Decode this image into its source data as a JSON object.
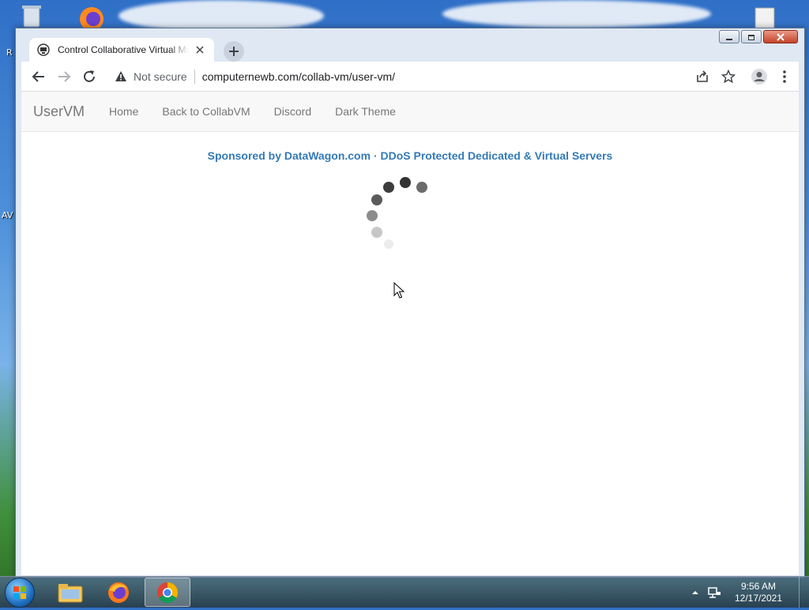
{
  "desktop": {
    "labels": [
      "R",
      "AV"
    ]
  },
  "browser": {
    "tab": {
      "title": "Control Collaborative Virtual Machine"
    },
    "omnibox": {
      "security_label": "Not secure",
      "url": "computernewb.com/collab-vm/user-vm/"
    }
  },
  "page": {
    "navbar": {
      "brand": "UserVM",
      "links": [
        "Home",
        "Back to CollabVM",
        "Discord",
        "Dark Theme"
      ]
    },
    "sponsor_text": "Sponsored by DataWagon.com · DDoS Protected Dedicated & Virtual Servers"
  },
  "taskbar": {
    "clock_time": "9:56 AM",
    "clock_date": "12/17/2021"
  },
  "colors": {
    "sponsor_link": "#337ab7",
    "navbar_bg": "#f8f8f8"
  }
}
